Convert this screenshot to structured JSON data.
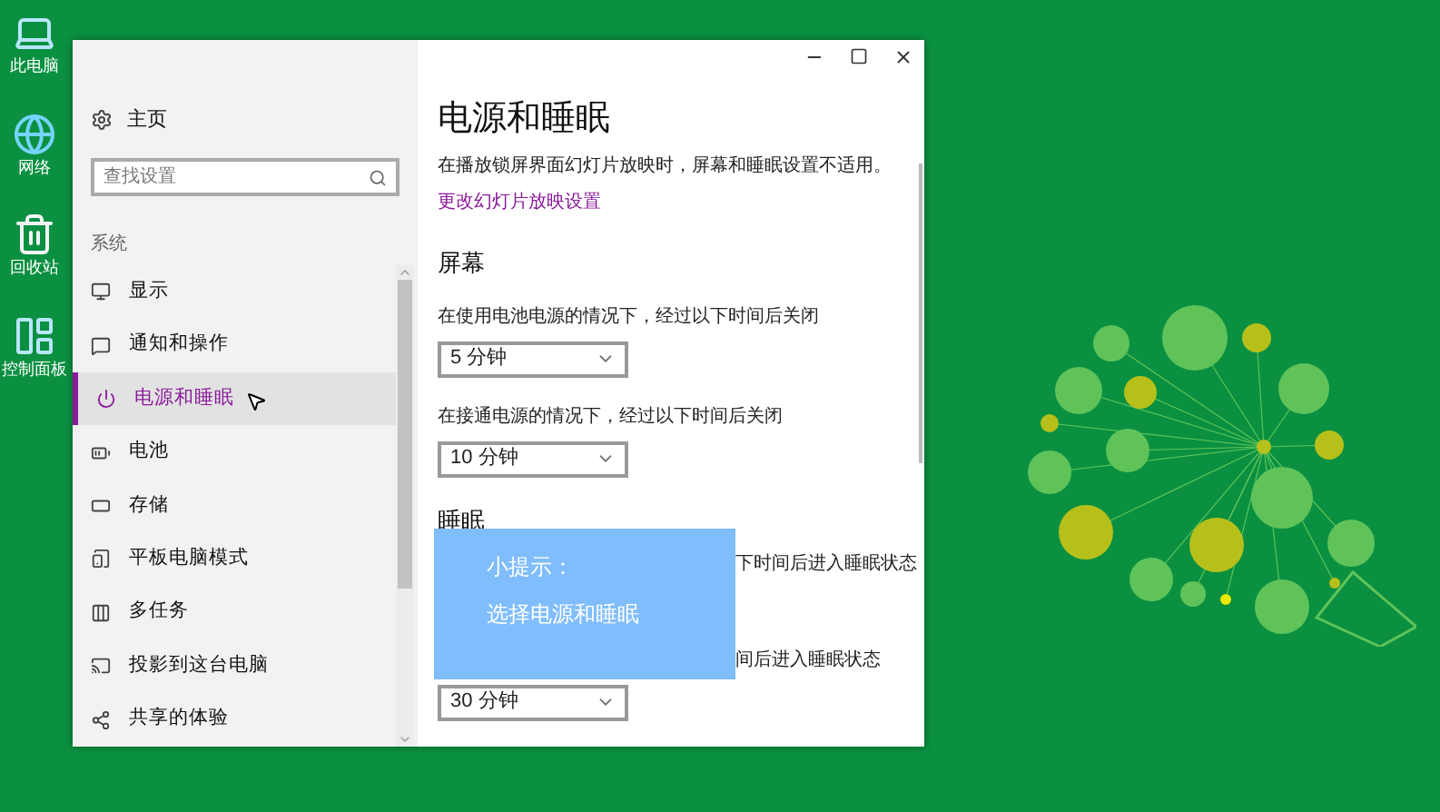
{
  "desktop_icons": [
    {
      "kind": "computer",
      "label": "此电脑"
    },
    {
      "kind": "network",
      "label": "网络"
    },
    {
      "kind": "recycle",
      "label": "回收站"
    },
    {
      "kind": "control",
      "label": "控制面板"
    }
  ],
  "sidebar": {
    "home": "主页",
    "search": {
      "placeholder": "查找设置"
    },
    "section": "系统",
    "items": [
      {
        "kind": "display",
        "label": "显示",
        "selected": false
      },
      {
        "kind": "notify",
        "label": "通知和操作",
        "selected": false
      },
      {
        "kind": "power",
        "label": "电源和睡眠",
        "selected": true
      },
      {
        "kind": "battery",
        "label": "电池",
        "selected": false
      },
      {
        "kind": "storage",
        "label": "存储",
        "selected": false
      },
      {
        "kind": "tablet",
        "label": "平板电脑模式",
        "selected": false
      },
      {
        "kind": "multitask",
        "label": "多任务",
        "selected": false
      },
      {
        "kind": "project",
        "label": "投影到这台电脑",
        "selected": false
      },
      {
        "kind": "share",
        "label": "共享的体验",
        "selected": false
      }
    ]
  },
  "content": {
    "title": "电源和睡眠",
    "note": "在播放锁屏界面幻灯片放映时，屏幕和睡眠设置不适用。",
    "link": "更改幻灯片放映设置",
    "screen": {
      "heading": "屏幕",
      "settings": [
        {
          "label": "在使用电池电源的情况下，经过以下时间后关闭",
          "value": "5 分钟"
        },
        {
          "label": "在接通电源的情况下，经过以下时间后关闭",
          "value": "10 分钟"
        }
      ]
    },
    "sleep": {
      "heading": "睡眠",
      "label_1": "下时间后进入睡眠状态",
      "label_2": "间后进入睡眠状态",
      "value": "30 分钟"
    }
  },
  "tip": {
    "title": "小提示：",
    "text": "选择电源和睡眠"
  }
}
